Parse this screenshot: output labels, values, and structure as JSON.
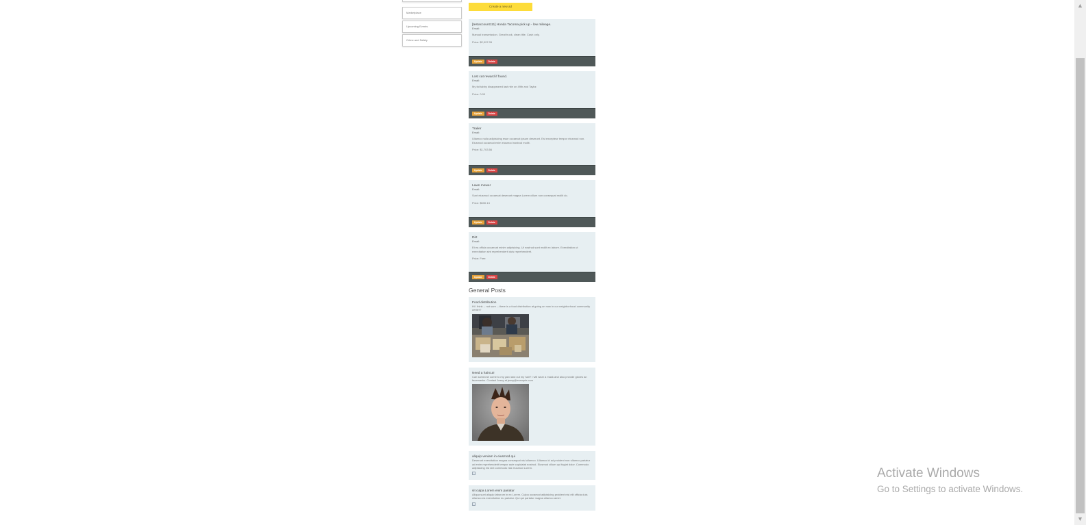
{
  "sidebar": {
    "items": [
      {
        "label": "Marketplace"
      },
      {
        "label": "Upcoming Events"
      },
      {
        "label": "Crime and Safety"
      }
    ]
  },
  "main": {
    "create_label": "Create a new ad",
    "ads": [
      {
        "title": "[testaccount111] Honda Tacoma pick up - low mileage.",
        "email": "Email:",
        "description": "Manual transmission. Great truck, clean title. Cash only.",
        "price": "Price: $2,097.05",
        "update_label": "Update",
        "delete_label": "Delete"
      },
      {
        "title": "Lost cat reward if found.",
        "email": "Email:",
        "description": "My fat tabby disappeared last nite on 49th and Taylor.",
        "price": "Price: 0.00",
        "update_label": "Update",
        "delete_label": "Delete"
      },
      {
        "title": "Trailer",
        "email": "Email:",
        "description": "Ullamco nulla adipisicing esse occaecat ipsum deserunt. Est excepteur tempor eiusmod non. Eiusmod occaecat enim eiusmod nostrud mollit.",
        "price": "Price: $1,703.56",
        "update_label": "Update",
        "delete_label": "Delete"
      },
      {
        "title": "Lawn mower",
        "email": "Email:",
        "description": "Sunt eiusmod occaecat deserunt magna Lorem cillum non consequat mollit do.",
        "price": "Price: $530.13",
        "update_label": "Update",
        "delete_label": "Delete"
      },
      {
        "title": "Dirt",
        "email": "Email:",
        "description": "Et ea officia occaecat minim adipisicing. Ut nostrud sunt mollit ex labore. Exercitation ut exercitation sint reprehenderit duis reprehenderit.",
        "price": "Price: Free",
        "update_label": "Update",
        "delete_label": "Delete"
      }
    ],
    "general_heading": "General Posts",
    "posts": [
      {
        "title": "Food distribution",
        "body": "Hi I think -- not sure -- there is a food distribution at going on now in our neighborhood community center?",
        "image": "photo"
      },
      {
        "title": "Need a haircut!",
        "body": "Can someone come to my yard and cut my hair? I will wear a mask and also provide gloves an facemasks. Contact Jessy at jessy@example.com",
        "image": "photo"
      },
      {
        "title": "aliquip veniam in eiusmod qui",
        "body": "Deserunt exercitation magna consequat nisi ullamco. Ullamco id ad proident non ullamco pariatur ad enim reprehenderit tempor aute cupidatat nostrud. Eiusmod cillum qui fugiat dolor. Commodo adipisicing est sint commodo nisi eiusmod Lorem.",
        "image": "broken"
      },
      {
        "title": "sit culpa Lorem enim pariatur",
        "body": "Aliqua sunt aliquip laborum in ex Lorem. Culpa occaecat adipisicing proident nisi elit officia duis ullamco ea exercitation eu pariatur. Qui qui pariatur magna ullamco amet.",
        "image": "broken"
      }
    ]
  },
  "watermark": {
    "line1": "Activate Windows",
    "line2": "Go to Settings to activate Windows."
  },
  "scrollbar": {
    "up_icon": "chevron-up-icon",
    "down_icon": "chevron-down-icon"
  },
  "colors": {
    "create_button": "#fddc3a",
    "card_background": "#e7eff2",
    "card_footer": "#4f5858",
    "update_button": "#e6a23a",
    "delete_button": "#d94545"
  }
}
